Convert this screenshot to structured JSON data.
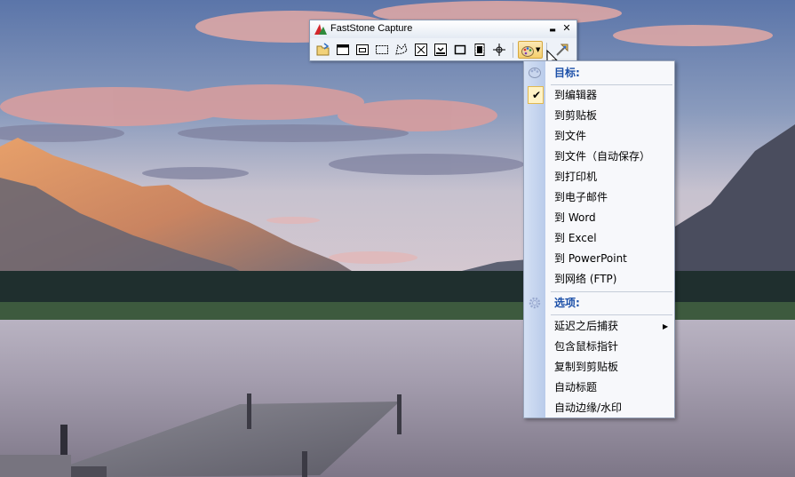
{
  "window": {
    "title": "FastStone Capture",
    "minimize_glyph": "▬",
    "close_glyph": "✕"
  },
  "toolbar": {
    "buttons": [
      {
        "icon": "open-folder-icon"
      },
      {
        "icon": "capture-active-window-icon"
      },
      {
        "icon": "capture-window-object-icon"
      },
      {
        "icon": "capture-rectangular-region-icon"
      },
      {
        "icon": "capture-freehand-region-icon"
      },
      {
        "icon": "capture-full-screen-icon"
      },
      {
        "icon": "capture-scrolling-window-icon"
      },
      {
        "icon": "capture-fixed-region-icon"
      },
      {
        "icon": "screen-recorder-icon"
      },
      {
        "icon": "crosshair-icon"
      },
      {
        "icon": "output-palette-icon",
        "active": true
      },
      {
        "icon": "settings-tool-icon"
      }
    ]
  },
  "menu": {
    "target_header": "目标:",
    "targets": [
      {
        "label": "到编辑器",
        "checked": true
      },
      {
        "label": "到剪贴板"
      },
      {
        "label": "到文件"
      },
      {
        "label": "到文件（自动保存）"
      },
      {
        "label": "到打印机"
      },
      {
        "label": "到电子邮件"
      },
      {
        "label": "到 Word"
      },
      {
        "label": "到 Excel"
      },
      {
        "label": "到 PowerPoint"
      },
      {
        "label": "到网络 (FTP)"
      }
    ],
    "options_header": "选项:",
    "options": [
      {
        "label": "延迟之后捕获",
        "submenu": true
      },
      {
        "label": "包含鼠标指针"
      },
      {
        "label": "复制到剪贴板"
      },
      {
        "label": "自动标题"
      },
      {
        "label": "自动边缘/水印"
      }
    ],
    "check_glyph": "✔",
    "submenu_glyph": "▶"
  },
  "colors": {
    "menu_header": "#1b4fa8",
    "sky_top": "#5a76a8",
    "lake": "#9c95a6",
    "accent_highlight": "#f5cf6e"
  }
}
